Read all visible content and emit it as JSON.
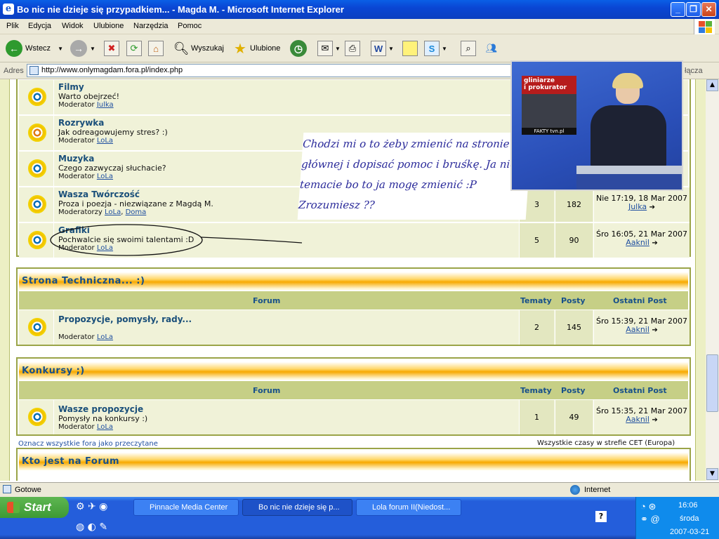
{
  "window": {
    "title": "Bo nic nie dzieje się przypadkiem... - Magda M. - Microsoft Internet Explorer"
  },
  "menu": [
    "Plik",
    "Edycja",
    "Widok",
    "Ulubione",
    "Narzędzia",
    "Pomoc"
  ],
  "toolbar": {
    "back": "Wstecz",
    "search": "Wyszukaj",
    "favorites": "Ulubione"
  },
  "address": {
    "label": "Adres",
    "url": "http://www.onlymagdam.fora.pl/index.php",
    "links": "łącza"
  },
  "forums_top": [
    {
      "name": "Filmy",
      "desc": "Warto obejrzeć!",
      "mod_label": "Moderator",
      "mods": [
        "Julka"
      ]
    },
    {
      "name": "Rozrywka",
      "desc": "Jak odreagowujemy stres? :)",
      "mod_label": "Moderator",
      "mods": [
        "LoLa"
      ]
    },
    {
      "name": "Muzyka",
      "desc": "Czego zazwyczaj słuchacie?",
      "mod_label": "Moderator",
      "mods": [
        "LoLa"
      ]
    },
    {
      "name": "Wasza Twórczość",
      "desc": "Proza i poezja - niezwiązane z Magdą M.",
      "mod_label": "Moderatorzy",
      "mods": [
        "LoLa",
        "Doma"
      ],
      "topics": "3",
      "posts": "182",
      "last_date": "Nie 17:19, 18 Mar 2007",
      "last_user": "Julka"
    },
    {
      "name": "Grafiki",
      "desc": "Pochwalcie się swoimi talentami :D",
      "mod_label": "Moderator",
      "mods": [
        "LoLa"
      ],
      "topics": "5",
      "posts": "90",
      "last_date": "Śro 16:05, 21 Mar 2007",
      "last_user": "Aaknil"
    }
  ],
  "categories": [
    {
      "title": "Strona Techniczna... :)",
      "headers": {
        "forum": "Forum",
        "topics": "Tematy",
        "posts": "Posty",
        "last": "Ostatni Post"
      },
      "forum": {
        "name": "Propozycje, pomysły, rady...",
        "desc": "",
        "mod_label": "Moderator",
        "mods": [
          "LoLa"
        ],
        "topics": "2",
        "posts": "145",
        "last_date": "Śro 15:39, 21 Mar 2007",
        "last_user": "Aaknil"
      }
    },
    {
      "title": "Konkursy ;)",
      "headers": {
        "forum": "Forum",
        "topics": "Tematy",
        "posts": "Posty",
        "last": "Ostatni Post"
      },
      "forum": {
        "name": "Wasze propozycje",
        "desc": "Pomysły na konkursy :)",
        "mod_label": "Moderator",
        "mods": [
          "LoLa"
        ],
        "topics": "1",
        "posts": "49",
        "last_date": "Śro 15:35, 21 Mar 2007",
        "last_user": "Aaknil"
      }
    }
  ],
  "footer": {
    "mark_read": "Oznacz wszystkie fora jako przeczytane",
    "timezone": "Wszystkie czasy w strefie CET (Europa)",
    "who_online": "Kto jest na Forum"
  },
  "note": {
    "lines": [
      "Chodzi mi o to żeby zmienić na stronie",
      "głównej i dopisać pomoc i bruśkę. Ja nie w",
      "temacie bo to ja mogę zmienić :P",
      "Zrozumiesz ??"
    ]
  },
  "tv": {
    "caption_line1": "gliniarze",
    "caption_line2": "i prokurator",
    "channel": "FAKTY",
    "channel_site": "tvn.pl"
  },
  "status": {
    "text": "Gotowe",
    "zone": "Internet"
  },
  "taskbar": {
    "start": "Start",
    "tasks": [
      "Pinnacle Media Center",
      "Bo nic nie dzieje się p...",
      "Lola forum II(Niedost..."
    ],
    "time": "16:06",
    "day": "środa",
    "date": "2007-03-21"
  },
  "colors": {
    "accent": "#0a46d4",
    "panel_border": "#9aa448",
    "row_bg": "#f0f2d8",
    "header_text": "#17508a"
  }
}
